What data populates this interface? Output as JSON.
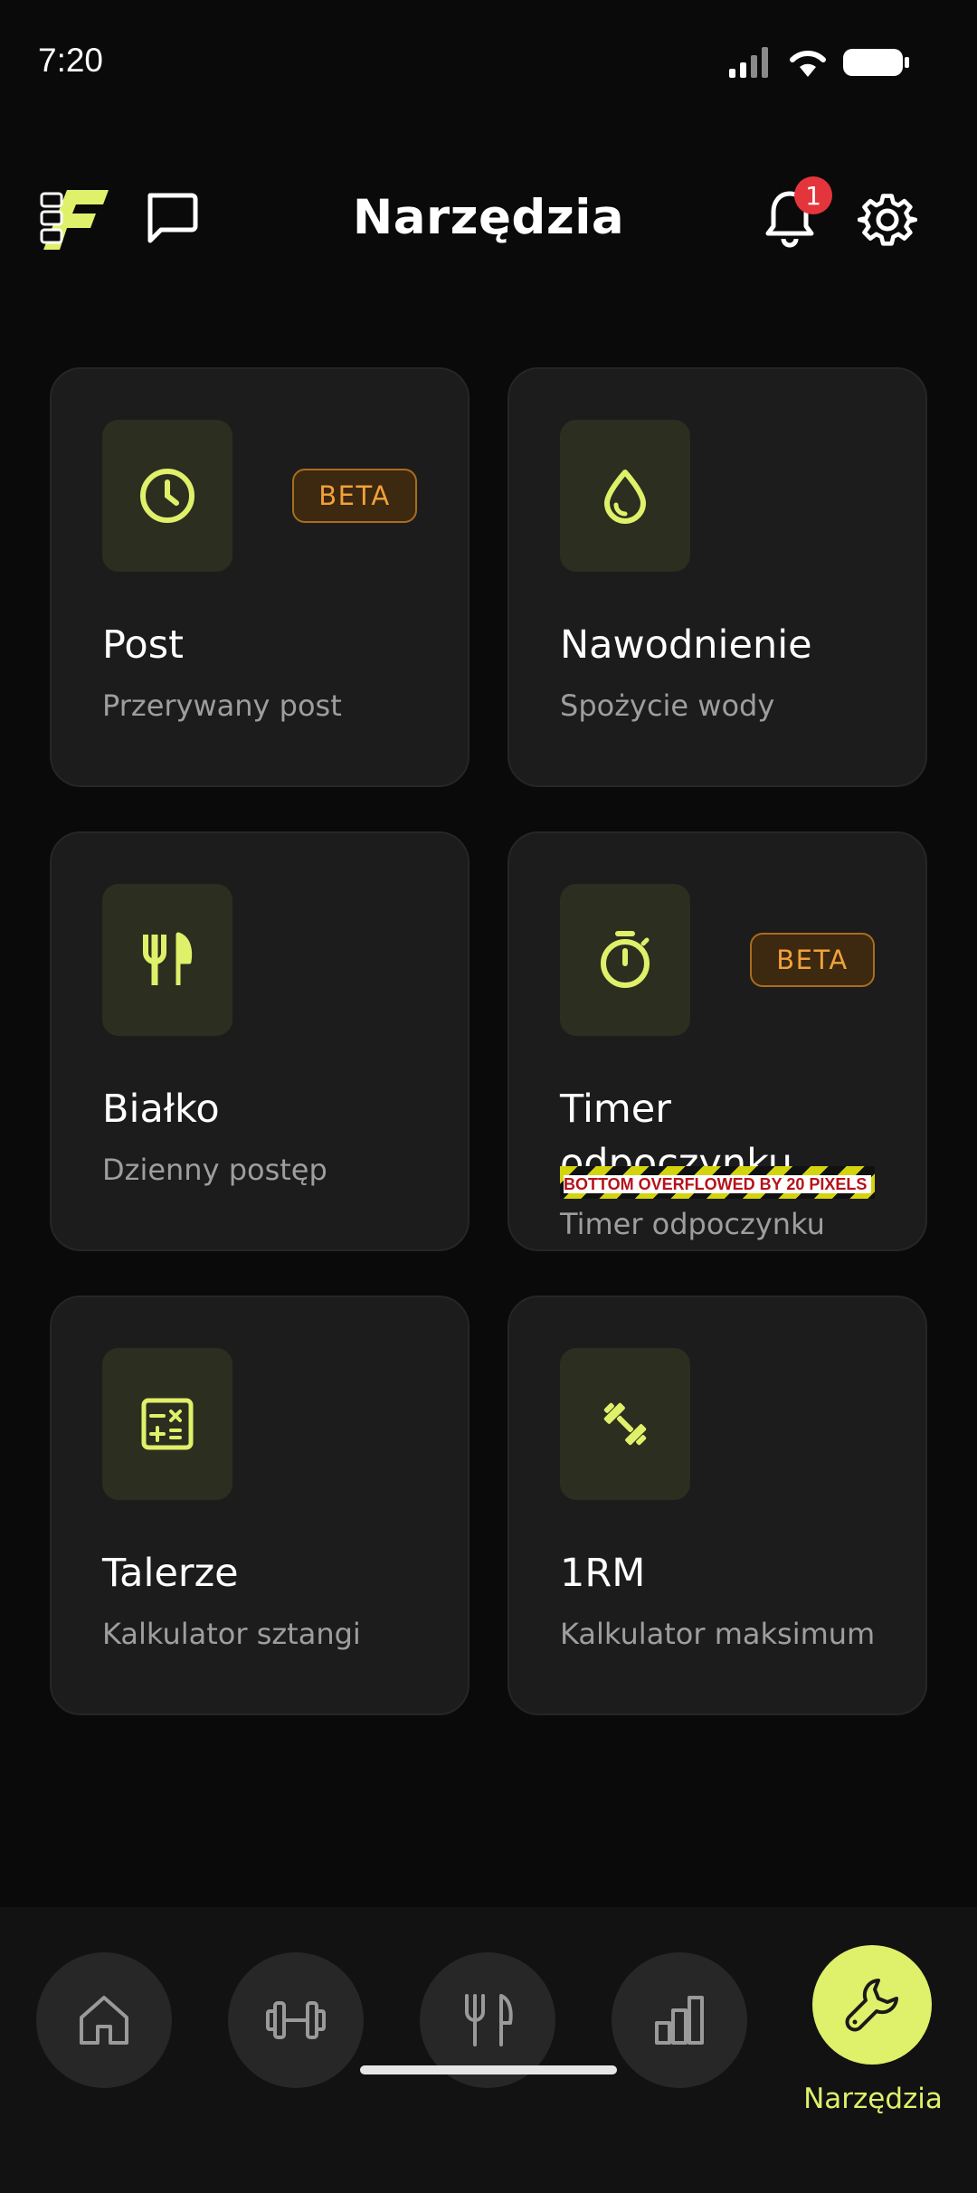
{
  "status_bar": {
    "time": "7:20"
  },
  "header": {
    "title": "Narzędzia",
    "notification_count": "1"
  },
  "colors": {
    "accent": "#dff06a",
    "beta": "#f0a23a",
    "badge": "#e5353c",
    "card_bg": "#1c1c1c"
  },
  "tools": [
    {
      "title": "Post",
      "subtitle": "Przerywany post",
      "icon": "clock-icon",
      "badge": "BETA"
    },
    {
      "title": "Nawodnienie",
      "subtitle": "Spożycie wody",
      "icon": "water-drop-icon"
    },
    {
      "title": "Białko",
      "subtitle": "Dzienny postęp",
      "icon": "fork-knife-icon"
    },
    {
      "title": "Timer odpoczynku",
      "subtitle": "Timer odpoczynku",
      "icon": "stopwatch-icon",
      "badge": "BETA",
      "overflow_warning": "BOTTOM OVERFLOWED BY 20 PIXELS"
    },
    {
      "title": "Talerze",
      "subtitle": "Kalkulator sztangi",
      "icon": "calculator-icon"
    },
    {
      "title": "1RM",
      "subtitle": "Kalkulator maksimum",
      "icon": "dumbbell-icon"
    }
  ],
  "nav": {
    "items": [
      {
        "icon": "home-icon"
      },
      {
        "icon": "dumbbell-icon"
      },
      {
        "icon": "fork-knife-icon"
      },
      {
        "icon": "bar-chart-icon"
      },
      {
        "icon": "wrench-icon",
        "label": "Narzędzia",
        "active": true
      }
    ]
  }
}
